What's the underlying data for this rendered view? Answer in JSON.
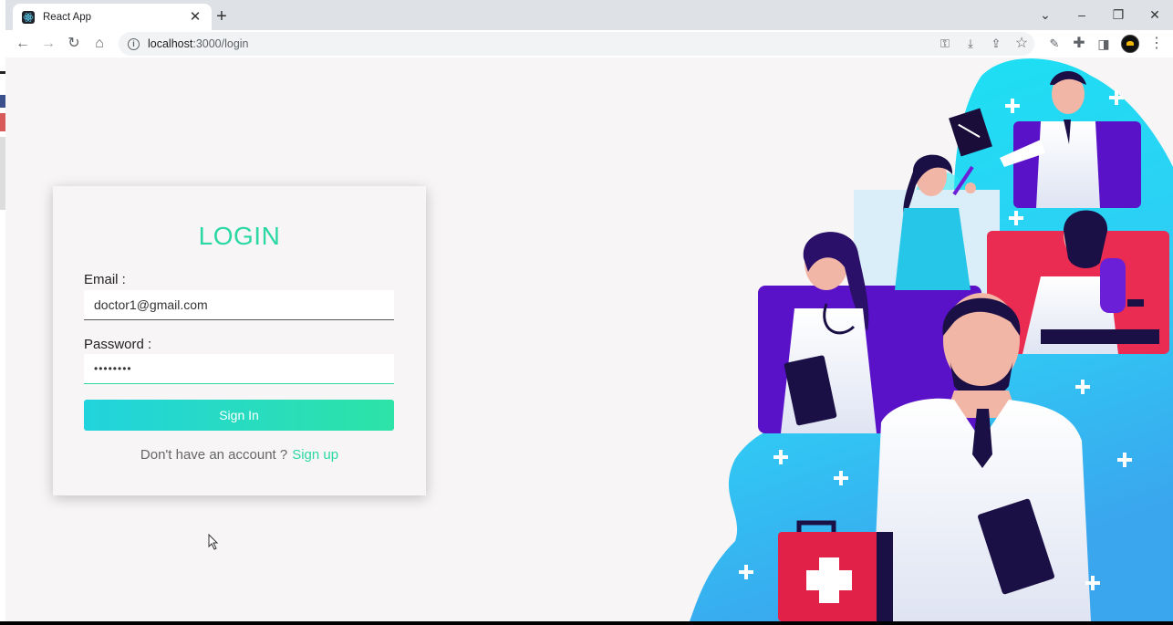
{
  "browser": {
    "tab_title": "React App",
    "url_host": "localhost",
    "url_path": ":3000/login"
  },
  "login": {
    "heading": "LOGIN",
    "email_label": "Email :",
    "email_value": "doctor1@gmail.com",
    "password_label": "Password :",
    "password_value": "••••••••",
    "signin_button": "Sign In",
    "signup_prompt": "Don't have an account ?",
    "signup_link": "Sign up"
  },
  "colors": {
    "accent": "#2bd8a4",
    "button_gradient_start": "#21d3dd",
    "button_gradient_end": "#2de3a6",
    "page_background": "#f7f5f5"
  },
  "illustration": {
    "icon": "doctors-illustration"
  }
}
